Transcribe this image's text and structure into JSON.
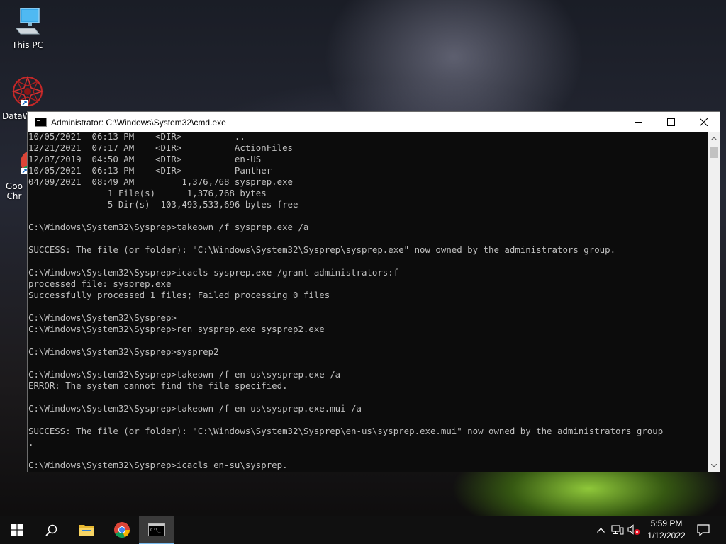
{
  "desktop": {
    "icons": [
      {
        "label": "This PC"
      },
      {
        "label": "DataW"
      },
      {
        "label": "Goo Chr"
      }
    ]
  },
  "window": {
    "title": "Administrator: C:\\Windows\\System32\\cmd.exe",
    "controls": {
      "minimize": "—",
      "maximize": "☐",
      "close": "✕"
    }
  },
  "console": {
    "lines": [
      "10/05/2021  06:13 PM    <DIR>          ..",
      "12/21/2021  07:17 AM    <DIR>          ActionFiles",
      "12/07/2019  04:50 AM    <DIR>          en-US",
      "10/05/2021  06:13 PM    <DIR>          Panther",
      "04/09/2021  08:49 AM         1,376,768 sysprep.exe",
      "               1 File(s)      1,376,768 bytes",
      "               5 Dir(s)  103,493,533,696 bytes free",
      "",
      "C:\\Windows\\System32\\Sysprep>takeown /f sysprep.exe /a",
      "",
      "SUCCESS: The file (or folder): \"C:\\Windows\\System32\\Sysprep\\sysprep.exe\" now owned by the administrators group.",
      "",
      "C:\\Windows\\System32\\Sysprep>icacls sysprep.exe /grant administrators:f",
      "processed file: sysprep.exe",
      "Successfully processed 1 files; Failed processing 0 files",
      "",
      "C:\\Windows\\System32\\Sysprep>",
      "C:\\Windows\\System32\\Sysprep>ren sysprep.exe sysprep2.exe",
      "",
      "C:\\Windows\\System32\\Sysprep>sysprep2",
      "",
      "C:\\Windows\\System32\\Sysprep>takeown /f en-us\\sysprep.exe /a",
      "ERROR: The system cannot find the file specified.",
      "",
      "C:\\Windows\\System32\\Sysprep>takeown /f en-us\\sysprep.exe.mui /a",
      "",
      "SUCCESS: The file (or folder): \"C:\\Windows\\System32\\Sysprep\\en-us\\sysprep.exe.mui\" now owned by the administrators group",
      ".",
      "",
      "C:\\Windows\\System32\\Sysprep>icacls en-su\\sysprep."
    ]
  },
  "taskbar": {
    "items": [
      "start-icon",
      "search-icon",
      "file-explorer-icon",
      "chrome-icon",
      "cmd-icon"
    ],
    "clock": {
      "time": "5:59 PM",
      "date": "1/12/2022"
    }
  },
  "colors": {
    "console_bg": "#0c0c0c",
    "console_text": "#c0c0c0",
    "taskbar_bg": "#101010",
    "accent": "#76b9ed"
  }
}
